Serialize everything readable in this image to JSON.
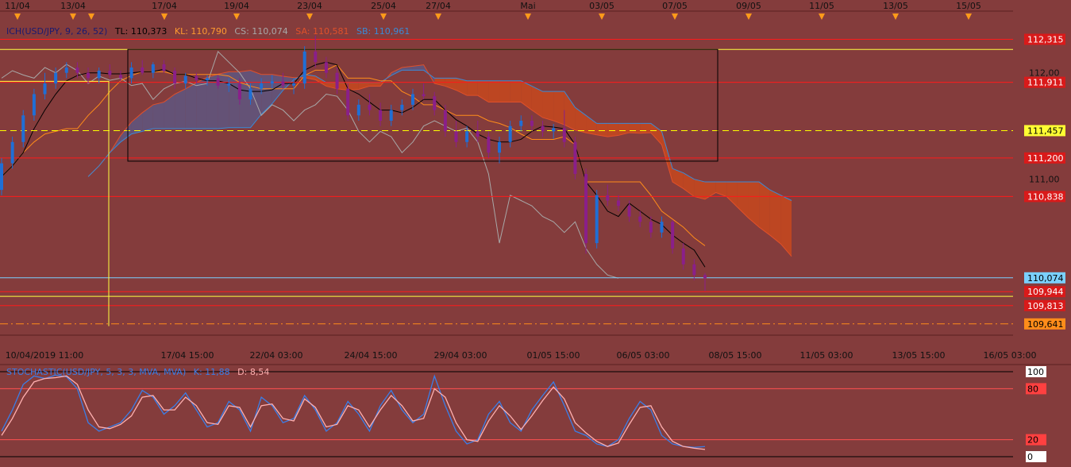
{
  "chart_data": {
    "type": "candlestick",
    "symbol": "USD/JPY",
    "top_dates": [
      "11/04",
      "13/04",
      "17/04",
      "19/04",
      "23/04",
      "25/04",
      "27/04",
      "Mai",
      "03/05",
      "07/05",
      "09/05",
      "11/05",
      "13/05",
      "15/05"
    ],
    "bottom_dates": [
      "10/04/2019 11:00",
      "17/04 15:00",
      "22/04 03:00",
      "24/04 15:00",
      "29/04 03:00",
      "01/05 15:00",
      "06/05 03:00",
      "08/05 15:00",
      "11/05 03:00",
      "13/05 15:00",
      "16/05 03:00"
    ],
    "price_axis": {
      "ylim": [
        109.55,
        112.55
      ],
      "ticks": [
        "112,00",
        "111,00"
      ]
    },
    "legend": {
      "title": "ICH(USD/JPY, 9, 26, 52)",
      "tl": "TL: 110,373",
      "kl": "KL: 110,790",
      "cs": "CS: 110,074",
      "sa": "SA: 110,581",
      "sb": "SB: 110,961"
    },
    "levels": [
      {
        "label": "112,315",
        "value": 112.315,
        "color": "#ff1a1a",
        "box": "#d91a1a",
        "text": "#ffffff"
      },
      {
        "label": "111,911",
        "value": 111.911,
        "color": "#ff1a1a",
        "box": "#d91a1a",
        "text": "#ffffff"
      },
      {
        "label": "111,457",
        "value": 111.457,
        "color": "#ffff00",
        "box": "#ffff33",
        "text": "#000000"
      },
      {
        "label": "111,200",
        "value": 111.2,
        "color": "#ff1a1a",
        "box": "#d91a1a",
        "text": "#ffffff"
      },
      {
        "label": "110,838",
        "value": 110.838,
        "color": "#ff1a1a",
        "box": "#d91a1a",
        "text": "#ffffff"
      },
      {
        "label": "110,074",
        "value": 110.074,
        "color": "#7ad0ff",
        "box": "#7ad0ff",
        "text": "#000000"
      },
      {
        "label": "109,944",
        "value": 109.944,
        "color": "#ff1a1a",
        "box": "#d91a1a",
        "text": "#ffffff"
      },
      {
        "label": "109,813",
        "value": 109.813,
        "color": "#ff1a1a",
        "box": "#d91a1a",
        "text": "#ffffff"
      },
      {
        "label": "109,641",
        "value": 109.641,
        "color": "#ff8c1a",
        "box": "#ff8c1a",
        "text": "#000000"
      }
    ],
    "candles": [
      [
        110.9,
        111.2,
        110.85,
        111.15
      ],
      [
        111.15,
        111.4,
        111.1,
        111.35
      ],
      [
        111.35,
        111.65,
        111.3,
        111.6
      ],
      [
        111.6,
        111.85,
        111.55,
        111.8
      ],
      [
        111.8,
        112.0,
        111.75,
        111.9
      ],
      [
        111.9,
        112.05,
        111.85,
        112.0
      ],
      [
        112.0,
        112.1,
        111.95,
        112.05
      ],
      [
        112.05,
        112.1,
        111.95,
        112.0
      ],
      [
        112.0,
        112.05,
        111.9,
        111.95
      ],
      [
        111.95,
        112.05,
        111.9,
        112.02
      ],
      [
        112.02,
        112.08,
        111.95,
        111.98
      ],
      [
        111.98,
        112.02,
        111.92,
        111.95
      ],
      [
        111.95,
        112.1,
        111.9,
        112.05
      ],
      [
        112.05,
        112.12,
        111.98,
        112.0
      ],
      [
        112.0,
        112.1,
        111.95,
        112.08
      ],
      [
        112.08,
        112.12,
        112.0,
        112.02
      ],
      [
        112.02,
        112.05,
        111.85,
        111.9
      ],
      [
        111.9,
        112.0,
        111.85,
        111.97
      ],
      [
        111.97,
        112.0,
        111.9,
        111.93
      ],
      [
        111.93,
        111.98,
        111.88,
        111.95
      ],
      [
        111.95,
        111.98,
        111.85,
        111.88
      ],
      [
        111.88,
        111.95,
        111.82,
        111.9
      ],
      [
        111.9,
        111.95,
        111.7,
        111.75
      ],
      [
        111.75,
        111.9,
        111.7,
        111.85
      ],
      [
        111.85,
        111.95,
        111.8,
        111.9
      ],
      [
        111.9,
        111.98,
        111.85,
        111.92
      ],
      [
        111.92,
        112.0,
        111.85,
        111.88
      ],
      [
        111.88,
        111.95,
        111.8,
        111.9
      ],
      [
        111.9,
        112.25,
        111.85,
        112.2
      ],
      [
        112.2,
        112.35,
        112.05,
        112.1
      ],
      [
        112.1,
        112.15,
        111.95,
        112.0
      ],
      [
        112.0,
        112.05,
        111.8,
        111.85
      ],
      [
        111.85,
        111.9,
        111.55,
        111.6
      ],
      [
        111.6,
        111.75,
        111.55,
        111.7
      ],
      [
        111.7,
        111.8,
        111.6,
        111.65
      ],
      [
        111.65,
        111.72,
        111.5,
        111.55
      ],
      [
        111.55,
        111.7,
        111.5,
        111.65
      ],
      [
        111.65,
        111.75,
        111.6,
        111.7
      ],
      [
        111.7,
        111.85,
        111.65,
        111.8
      ],
      [
        111.8,
        111.9,
        111.75,
        111.78
      ],
      [
        111.78,
        111.82,
        111.6,
        111.65
      ],
      [
        111.65,
        111.7,
        111.4,
        111.45
      ],
      [
        111.45,
        111.55,
        111.3,
        111.35
      ],
      [
        111.35,
        111.5,
        111.3,
        111.45
      ],
      [
        111.45,
        111.55,
        111.35,
        111.4
      ],
      [
        111.4,
        111.45,
        111.2,
        111.25
      ],
      [
        111.25,
        111.4,
        111.15,
        111.35
      ],
      [
        111.35,
        111.55,
        111.3,
        111.5
      ],
      [
        111.5,
        111.6,
        111.45,
        111.55
      ],
      [
        111.55,
        111.6,
        111.45,
        111.5
      ],
      [
        111.5,
        111.55,
        111.4,
        111.45
      ],
      [
        111.45,
        111.52,
        111.38,
        111.48
      ],
      [
        111.48,
        111.65,
        111.3,
        111.35
      ],
      [
        111.35,
        111.4,
        111.0,
        111.05
      ],
      [
        111.05,
        111.1,
        110.3,
        110.4
      ],
      [
        110.4,
        110.9,
        110.35,
        110.85
      ],
      [
        110.85,
        110.95,
        110.75,
        110.8
      ],
      [
        110.8,
        110.85,
        110.7,
        110.75
      ],
      [
        110.75,
        110.8,
        110.6,
        110.65
      ],
      [
        110.65,
        110.7,
        110.55,
        110.6
      ],
      [
        110.6,
        110.65,
        110.45,
        110.5
      ],
      [
        110.5,
        110.65,
        110.45,
        110.6
      ],
      [
        110.6,
        110.62,
        110.3,
        110.35
      ],
      [
        110.35,
        110.4,
        110.15,
        110.2
      ],
      [
        110.2,
        110.25,
        110.05,
        110.1
      ],
      [
        110.1,
        110.12,
        109.95,
        110.07
      ]
    ],
    "stochastic": {
      "legend_title": "STOCHASTIC(USD/JPY, 5, 3, 3, MVA, MVA)",
      "k_label": "K: 11,88",
      "d_label": "D: 8,54",
      "levels": [
        "100",
        "80",
        "20",
        "0"
      ],
      "k": [
        30,
        55,
        85,
        95,
        92,
        96,
        94,
        80,
        40,
        30,
        35,
        40,
        55,
        78,
        70,
        50,
        60,
        75,
        55,
        35,
        40,
        65,
        55,
        30,
        70,
        60,
        40,
        45,
        72,
        55,
        30,
        40,
        65,
        50,
        30,
        60,
        78,
        55,
        40,
        50,
        95,
        60,
        30,
        15,
        20,
        50,
        65,
        40,
        30,
        55,
        72,
        88,
        60,
        30,
        25,
        15,
        12,
        20,
        45,
        65,
        55,
        25,
        15,
        12,
        11,
        11.88
      ],
      "d": [
        25,
        45,
        70,
        88,
        92,
        93,
        95,
        85,
        55,
        35,
        33,
        38,
        48,
        70,
        72,
        55,
        55,
        70,
        60,
        40,
        38,
        60,
        58,
        35,
        60,
        62,
        45,
        42,
        68,
        58,
        35,
        38,
        60,
        55,
        35,
        55,
        72,
        60,
        42,
        45,
        80,
        70,
        40,
        20,
        18,
        42,
        60,
        48,
        32,
        48,
        66,
        82,
        68,
        40,
        28,
        18,
        12,
        16,
        38,
        58,
        60,
        35,
        18,
        12,
        10,
        8.54
      ]
    }
  },
  "colors": {
    "background": "#843c3c",
    "bull": "#1f6fd6",
    "bear": "#8a1f8a",
    "tenkan": "#000000",
    "kijun": "#ff8c1a",
    "chikou": "#a8a8a8",
    "senkou_a": "#e0502a",
    "senkou_b": "#3a8ad6",
    "cloud_up": "#5a5a8a",
    "cloud_down": "#d04a1a",
    "stoch_k": "#3a7ee8",
    "stoch_d": "#ffb0b0"
  }
}
